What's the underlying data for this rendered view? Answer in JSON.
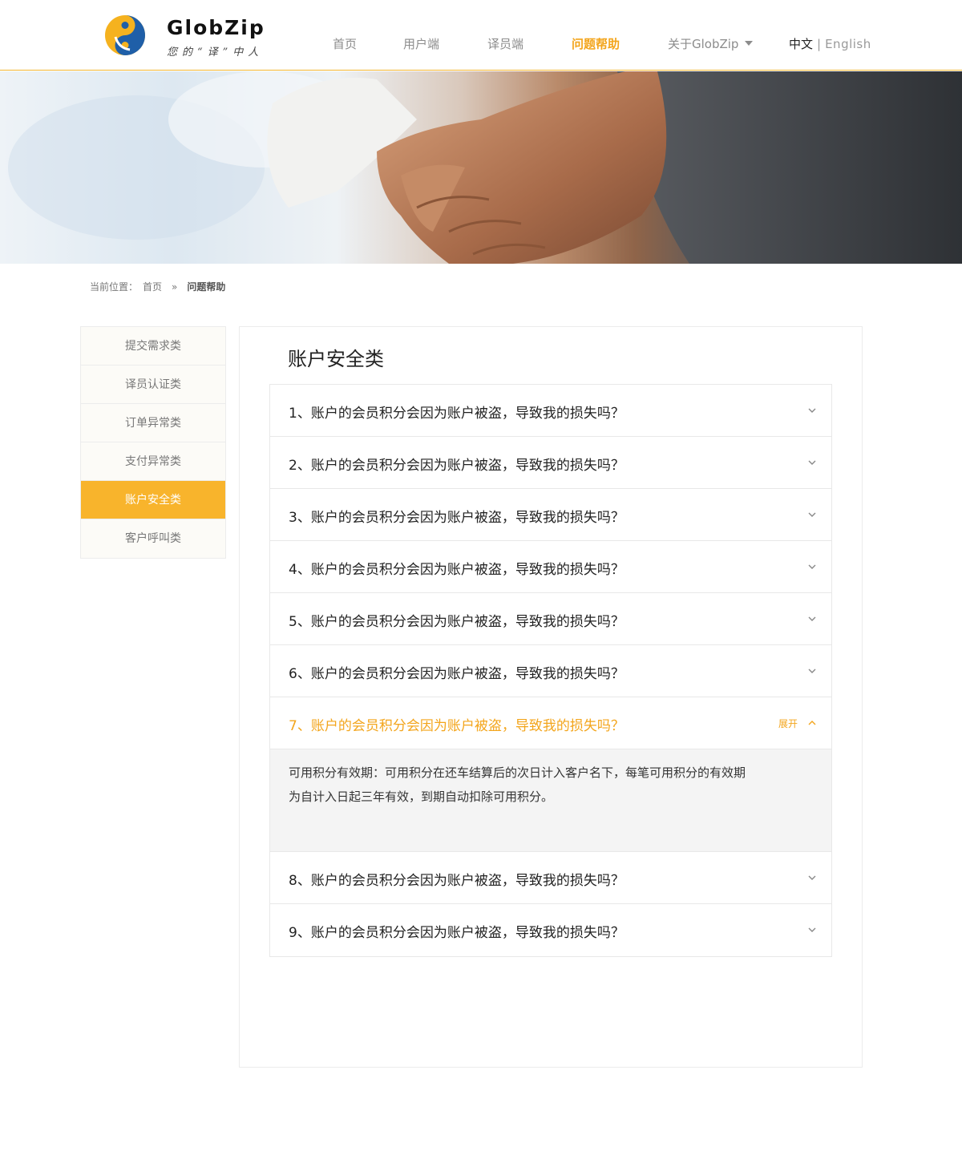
{
  "brand": {
    "name": "GlobZip",
    "slogan": "您的“译”中人"
  },
  "nav": {
    "items": [
      {
        "label": "首页"
      },
      {
        "label": "用户端"
      },
      {
        "label": "译员端"
      },
      {
        "label": "问题帮助"
      },
      {
        "label": "关于GlobZip"
      }
    ],
    "active": "问题帮助",
    "lang_zh": "中文",
    "lang_sep": "|",
    "lang_en": "English"
  },
  "breadcrumb": {
    "prefix": "当前位置：",
    "home": "首页",
    "sep": "»",
    "current": "问题帮助"
  },
  "sidebar": {
    "items": [
      {
        "label": "提交需求类"
      },
      {
        "label": "译员认证类"
      },
      {
        "label": "订单异常类"
      },
      {
        "label": "支付异常类"
      },
      {
        "label": "账户安全类"
      },
      {
        "label": "客户呼叫类"
      }
    ],
    "active": "账户安全类"
  },
  "main": {
    "title": "账户安全类",
    "questions": [
      {
        "text": "1、账户的会员积分会因为账户被盗，导致我的损失吗？"
      },
      {
        "text": "2、账户的会员积分会因为账户被盗，导致我的损失吗？"
      },
      {
        "text": "3、账户的会员积分会因为账户被盗，导致我的损失吗？"
      },
      {
        "text": "4、账户的会员积分会因为账户被盗，导致我的损失吗？"
      },
      {
        "text": "5、账户的会员积分会因为账户被盗，导致我的损失吗？"
      },
      {
        "text": "6、账户的会员积分会因为账户被盗，导致我的损失吗？"
      },
      {
        "text": "7、账户的会员积分会因为账户被盗，导致我的损失吗？"
      },
      {
        "text": "8、账户的会员积分会因为账户被盗，导致我的损失吗？"
      },
      {
        "text": "9、账户的会员积分会因为账户被盗，导致我的损失吗？"
      }
    ],
    "open_index": 6,
    "expand_label": "展开",
    "answer": "可用积分有效期：可用积分在还车结算后的次日计入客户名下，每笔可用积分的有效期为自计入日起三年有效，到期自动扣除可用积分。"
  },
  "colors": {
    "accent": "#f8b42c",
    "accent_text": "#f3a51c",
    "logo_blue": "#1f5fa8",
    "logo_yellow": "#f5b21f"
  }
}
